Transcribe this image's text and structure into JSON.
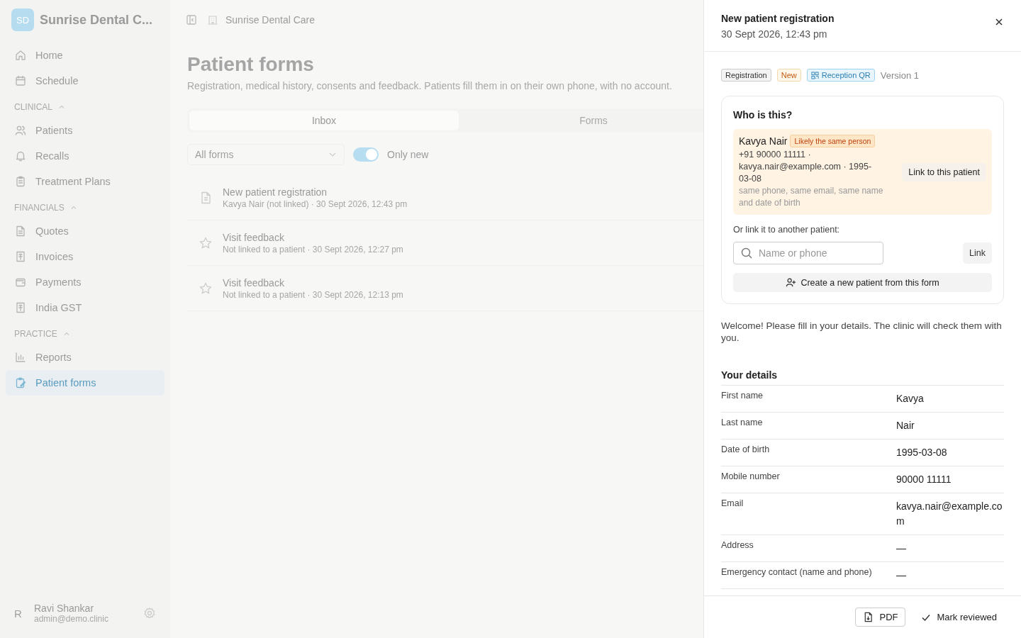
{
  "sidebar": {
    "logo": "SD",
    "clinic": "Sunrise Dental C...",
    "sections": [
      {
        "items": [
          {
            "label": "Home",
            "selected": false
          },
          {
            "label": "Schedule",
            "selected": false
          }
        ]
      },
      {
        "label": "CLINICAL",
        "expanded": true,
        "items": [
          {
            "label": "Patients",
            "selected": false
          },
          {
            "label": "Recalls",
            "selected": false
          },
          {
            "label": "Treatment Plans",
            "selected": false
          }
        ]
      },
      {
        "label": "FINANCIALS",
        "expanded": true,
        "items": [
          {
            "label": "Quotes",
            "selected": false
          },
          {
            "label": "Invoices",
            "selected": false
          },
          {
            "label": "Payments",
            "selected": false
          },
          {
            "label": "India GST",
            "selected": false
          }
        ]
      },
      {
        "label": "PRACTICE",
        "expanded": true,
        "items": [
          {
            "label": "Reports",
            "selected": false
          },
          {
            "label": "Patient forms",
            "selected": true
          }
        ]
      }
    ],
    "user": {
      "initial": "R",
      "name": "Ravi Shankar",
      "email": "admin@demo.clinic"
    }
  },
  "topbar": {
    "breadcrumb": "Sunrise Dental Care"
  },
  "page": {
    "title": "Patient forms",
    "subtitle": "Registration, medical history, consents and feedback. Patients fill them in on their own phone, with no account.",
    "tabs": [
      {
        "label": "Inbox",
        "selected": true
      },
      {
        "label": "Forms",
        "selected": false
      }
    ],
    "filter": {
      "value": "All forms"
    },
    "toggle": {
      "label": "Only new",
      "on": true
    },
    "submissions": [
      {
        "kind": "document",
        "title": "New patient registration",
        "subtitle": "Kavya Nair (not linked) · 30 Sept 2026, 12:43 pm"
      },
      {
        "kind": "feedback",
        "title": "Visit feedback",
        "subtitle": "Not linked to a patient · 30 Sept 2026, 12:27 pm"
      },
      {
        "kind": "feedback",
        "title": "Visit feedback",
        "subtitle": "Not linked to a patient · 30 Sept 2026, 12:13 pm"
      }
    ]
  },
  "drawer": {
    "title": "New patient registration",
    "date": "30 Sept 2026, 12:43 pm",
    "tags": [
      {
        "kind": "neutral",
        "label": "Registration"
      },
      {
        "kind": "warning",
        "label": "New"
      },
      {
        "kind": "info",
        "label": "Reception QR"
      }
    ],
    "version": "Version 1",
    "match_card": {
      "title": "Who is this?",
      "candidate": {
        "name": "Kavya Nair",
        "badge": "Likely the same person",
        "details": "+91 90000 11111 · kavya.nair@example.com · 1995-03-08",
        "reason": "same phone, same email, same name and date of birth",
        "button": "Link to this patient"
      },
      "other_label": "Or link it to another patient:",
      "search_placeholder": "Name or phone",
      "link_button": "Link",
      "create_button": "Create a new patient from this form"
    },
    "intro": "Welcome! Please fill in your details. The clinic will check them with you.",
    "section_title": "Your details",
    "fields": [
      {
        "label": "First name",
        "value": "Kavya"
      },
      {
        "label": "Last name",
        "value": "Nair"
      },
      {
        "label": "Date of birth",
        "value": "1995-03-08"
      },
      {
        "label": "Mobile number",
        "value": "90000 11111"
      },
      {
        "label": "Email",
        "value": "kavya.nair@example.com"
      },
      {
        "label": "Address",
        "value": "—"
      },
      {
        "label": "Emergency contact (name and phone)",
        "value": "—"
      }
    ],
    "footer": {
      "pdf": "PDF",
      "review": "Mark reviewed"
    }
  }
}
